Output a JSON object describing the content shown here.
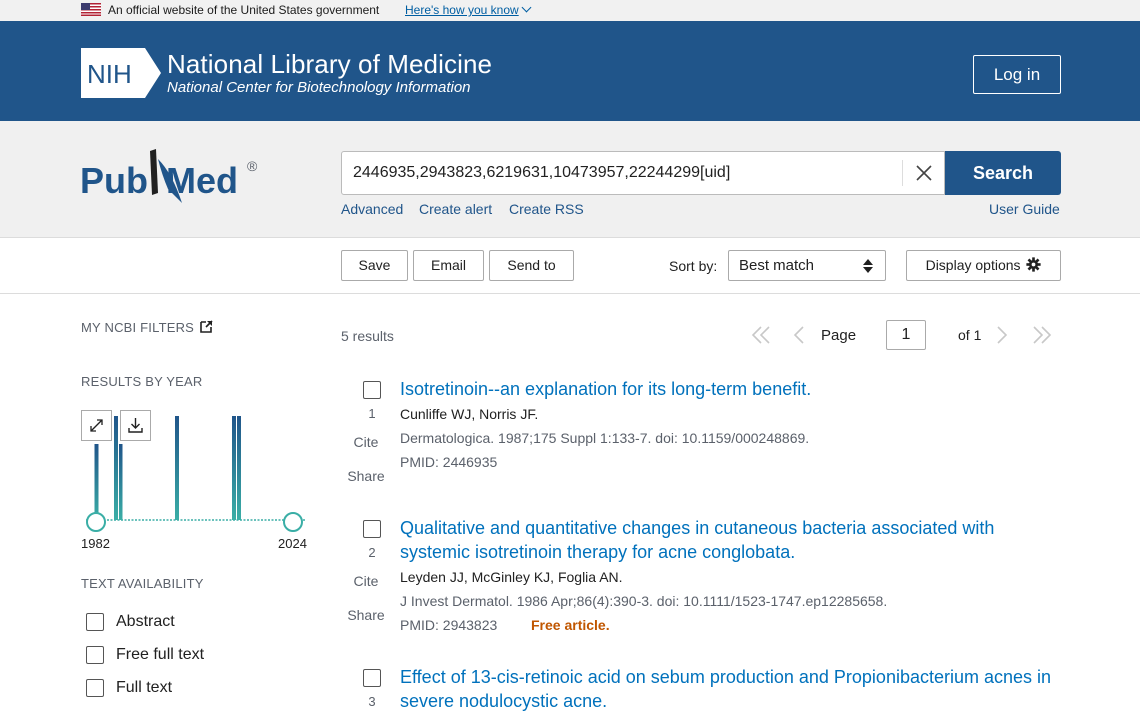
{
  "gov_banner": {
    "text": "An official website of the United States government",
    "link": "Here's how you know"
  },
  "header": {
    "logo_text": "NIH",
    "title": "National Library of Medicine",
    "subtitle": "National Center for Biotechnology Information",
    "login": "Log in"
  },
  "search": {
    "logo_pub": "Pub",
    "logo_med": "Med",
    "logo_reg": "®",
    "query": "2446935,2943823,6219631,10473957,22244299[uid]",
    "button": "Search",
    "links": [
      "Advanced",
      "Create alert",
      "Create RSS"
    ],
    "user_guide": "User Guide"
  },
  "toolbar": {
    "save": "Save",
    "email": "Email",
    "send_to": "Send to",
    "sort_label": "Sort by:",
    "sort_value": "Best match",
    "display_options": "Display options"
  },
  "sidebar": {
    "my_filters": "MY NCBI FILTERS",
    "results_by_year": "RESULTS BY YEAR",
    "year_start": "1982",
    "year_end": "2024",
    "text_availability": "TEXT AVAILABILITY",
    "filters": [
      "Abstract",
      "Free full text",
      "Full text"
    ]
  },
  "results_meta": {
    "count": "5 results",
    "page_label": "Page",
    "page_value": "1",
    "page_of": "of 1"
  },
  "results": [
    {
      "num": "1",
      "title": "Isotretinoin--an explanation for its long-term benefit.",
      "authors": "Cunliffe WJ, Norris JF.",
      "citation": "Dermatologica. 1987;175 Suppl 1:133-7. doi: 10.1159/000248869.",
      "pmid": "PMID: 2446935",
      "cite": "Cite",
      "share": "Share"
    },
    {
      "num": "2",
      "title": "Qualitative and quantitative changes in cutaneous bacteria associated with systemic isotretinoin therapy for acne conglobata.",
      "authors": "Leyden JJ, McGinley KJ, Foglia AN.",
      "citation": "J Invest Dermatol. 1986 Apr;86(4):390-3. doi: 10.1111/1523-1747.ep12285658.",
      "pmid": "PMID: 2943823",
      "free": "Free article.",
      "cite": "Cite",
      "share": "Share"
    },
    {
      "num": "3",
      "title": "Effect of 13-cis-retinoic acid on sebum production and Propionibacterium acnes in severe nodulocystic acne."
    }
  ],
  "colors": {
    "nih_blue": "#20558a",
    "link_blue": "#0071bc",
    "free_orange": "#c05600",
    "chart_teal": "#3aaea6"
  }
}
